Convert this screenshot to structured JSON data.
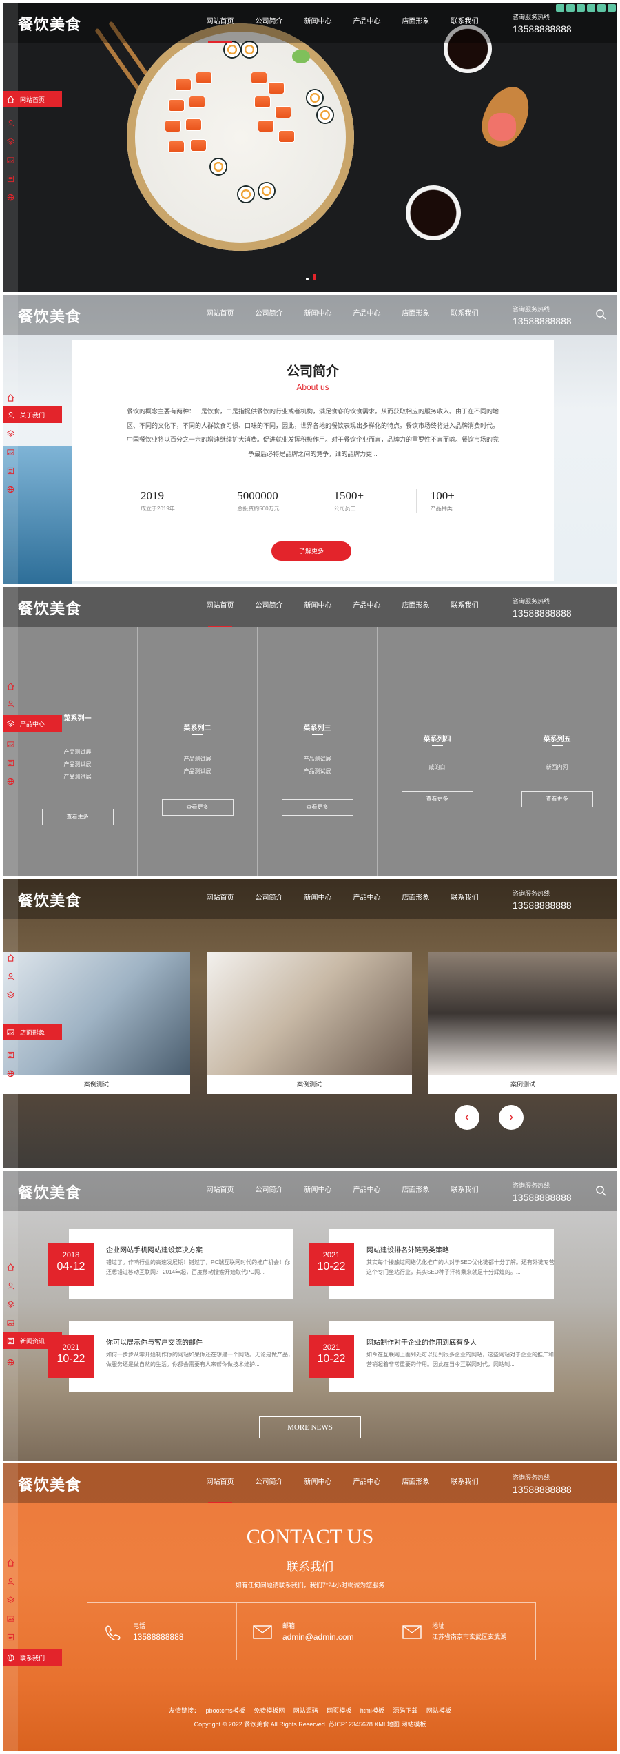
{
  "header": {
    "logo": "餐饮美食",
    "nav": [
      "网站首页",
      "公司简介",
      "新闻中心",
      "产品中心",
      "店面形象",
      "联系我们"
    ],
    "hotline_label": "咨询服务热线",
    "hotline": "13588888888"
  },
  "side_labels": {
    "home": "网站首页",
    "about": "关于我们",
    "products": "产品中心",
    "store": "店面形象",
    "news": "新闻资讯",
    "contact": "联系我们"
  },
  "about": {
    "title": "公司简介",
    "subtitle": "About us",
    "text": "餐饮的概念主要有两种：一是饮食，二是指提供餐饮的行业或者机构，满足食客的饮食需求。从而获取相应的服务收入。由于在不同的地区、不同的文化下，不同的人群饮食习惯、口味的不同，因此，世界各地的餐饮表现出多样化的特点。餐饮市场终将进入品牌消费时代。中国餐饮业将以百分之十六的增速继续扩大消费。促进就业发挥积极作用。对于餐饮企业而言，品牌力的重要性不言而喻。餐饮市场的竞争最后必将是品牌之间的竞争，谁的品牌力更...",
    "stats": [
      {
        "value": "2019",
        "label": "成立于2019年"
      },
      {
        "value": "5000000",
        "label": "总投资约500万元"
      },
      {
        "value": "1500+",
        "label": "公司员工"
      },
      {
        "value": "100+",
        "label": "产品种类"
      }
    ],
    "button": "了解更多"
  },
  "products": {
    "columns": [
      {
        "title": "菜系列一",
        "items": [
          "产品测试展",
          "产品测试展",
          "产品测试展"
        ],
        "button": "查看更多"
      },
      {
        "title": "菜系列二",
        "items": [
          "产品测试展",
          "产品测试展"
        ],
        "button": "查看更多"
      },
      {
        "title": "菜系列三",
        "items": [
          "产品测试展",
          "产品测试展"
        ],
        "button": "查看更多"
      },
      {
        "title": "菜系列四",
        "items": [
          "咸的白"
        ],
        "button": "查看更多"
      },
      {
        "title": "菜系列五",
        "items": [
          "新西内河"
        ],
        "button": "查看更多"
      }
    ]
  },
  "cases": {
    "items": [
      "案例测试",
      "案例测试",
      "案例测试"
    ],
    "prev": "‹",
    "next": "›"
  },
  "news": {
    "items": [
      {
        "year": "2018",
        "date": "04-12",
        "title": "企业网站手机网站建设解决方案",
        "desc": "错过了。作响行业的高速发展期！错过了，PC端互联网时代的推广机会！你还想错过移动互联网？ 2014年起，百度移动搜索开始取代PC网..."
      },
      {
        "year": "2021",
        "date": "10-22",
        "title": "网站建设排名外链另类策略",
        "desc": "其实每个接触过网络优化推广的人对于SEO优化链都十分了解。还有外链专营这个专门坐站行业，其实SEO种子汗将乘来就是十分辉煌的。..."
      },
      {
        "year": "2021",
        "date": "10-22",
        "title": "你可以展示你与客户交流的邮件",
        "desc": "如何一步步从零开始制作你的网站如果你还在想建一个网站。无论是做产品，做服务还是做自然的生活。你都会需要有人来帮你做技术维护..."
      },
      {
        "year": "2021",
        "date": "10-22",
        "title": "网站制作对于企业的作用到底有多大",
        "desc": "如今在互联网上面到处可以见到很多企业的网站，这些网站对于企业的推广和营销起着非常重要的作用。因此在当今互联网时代，网站制..."
      }
    ],
    "more": "MORE NEWS"
  },
  "contact": {
    "title_en": "CONTACT US",
    "title_cn": "联系我们",
    "tagline": "如有任何问题请联系我们，我们7*24小时竭诚为您服务",
    "phone_label": "电话",
    "phone": "13588888888",
    "email_label": "邮箱",
    "email": "admin@admin.com",
    "address_label": "地址",
    "address": "江苏省南京市玄武区玄武湖"
  },
  "footer": {
    "links_label": "友情链接：",
    "links": [
      "pbootcms模板",
      "免费模板网",
      "网站源码",
      "网页模板",
      "html模板",
      "源码下载",
      "网站模板"
    ],
    "copyright": "Copyright © 2022 餐饮美食 All Rights Reserved. 苏ICP12345678 XML地图 网站模板"
  },
  "colors": {
    "accent": "#e3242b",
    "orange": "#ec7a3c"
  }
}
